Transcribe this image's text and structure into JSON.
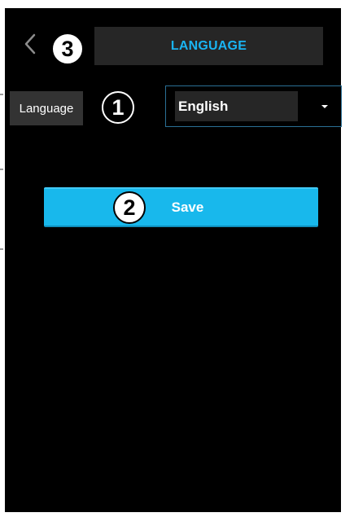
{
  "header": {
    "back_icon": "chevron-left-icon",
    "title": "LANGUAGE"
  },
  "settings": {
    "language_label": "Language",
    "language_value": "English",
    "dropdown_icon": "caret-down-icon"
  },
  "actions": {
    "save_label": "Save"
  },
  "callouts": {
    "one": "1",
    "two": "2",
    "three": "3"
  },
  "colors": {
    "accent": "#1ab4f2",
    "background": "#000000",
    "panel": "#262626",
    "label_bg": "#333333",
    "select_border": "#2a6f95"
  }
}
